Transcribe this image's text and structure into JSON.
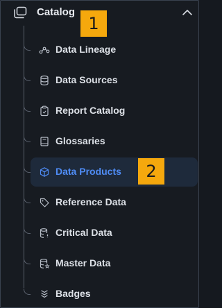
{
  "header": {
    "title": "Catalog",
    "icon": "catalog-folders-icon",
    "collapse_icon": "chevron-up-icon"
  },
  "badges": [
    {
      "label": "1"
    },
    {
      "label": "2"
    }
  ],
  "items": [
    {
      "label": "Data Lineage",
      "icon": "lineage-icon",
      "active": false
    },
    {
      "label": "Data Sources",
      "icon": "database-icon",
      "active": false
    },
    {
      "label": "Report Catalog",
      "icon": "clipboard-icon",
      "active": false
    },
    {
      "label": "Glossaries",
      "icon": "book-icon",
      "active": false
    },
    {
      "label": "Data Products",
      "icon": "cube-icon",
      "active": true
    },
    {
      "label": "Reference Data",
      "icon": "tag-icon",
      "active": false
    },
    {
      "label": "Critical Data",
      "icon": "database-alert-icon",
      "active": false
    },
    {
      "label": "Master Data",
      "icon": "database-star-icon",
      "active": false
    },
    {
      "label": "Badges",
      "icon": "badge-layers-icon",
      "active": false
    }
  ],
  "colors": {
    "background": "#171b21",
    "text": "#dde1e7",
    "active_text": "#4f8cf5",
    "active_bg": "#1e2a3b",
    "badge": "#f5a80d"
  }
}
